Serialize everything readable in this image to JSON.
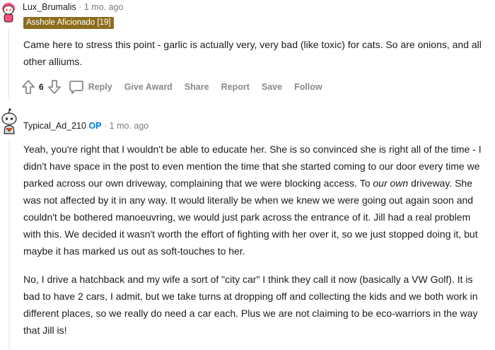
{
  "comment1": {
    "username": "Lux_Brumalis",
    "separator": "·",
    "time_ago": "1 mo. ago",
    "flair": "Asshole Aficionado [19]",
    "body": "Came here to stress this point - garlic is actually very, very bad (like toxic) for cats. So are onions, and all other alliums.",
    "vote_count": "6",
    "actions": {
      "reply": "Reply",
      "give_award": "Give Award",
      "share": "Share",
      "report": "Report",
      "save": "Save",
      "follow": "Follow"
    }
  },
  "comment2": {
    "username": "Typical_Ad_210",
    "op_badge": "OP",
    "separator": "·",
    "time_ago": "1 mo. ago",
    "paragraph1_before": "Yeah, you're right that I wouldn't be able to educate her. She is so convinced she is right all of the time - I didn't have space in the post to even mention the time that she started coming to our door every time we parked across our own driveway, complaining that we were blocking access. To ",
    "paragraph1_em": "our own",
    "paragraph1_after": " driveway. She was not affected by it in any way. It would literally be when we knew we were going out again soon and couldn't be bothered manoeuvring, we would just park across the entrance of it. Jill had a real problem with this. We decided it wasn't worth the effort of fighting with her over it, so we just stopped doing it, but maybe it has marked us out as soft-touches to her.",
    "paragraph2": "No, I drive a hatchback and my wife a sort of \"city car\" I think they call it now (basically a VW Golf). It is bad to have 2 cars, I admit, but we take turns at dropping off and collecting the kids and we both work in different places, so we really do need a car each. Plus we are not claiming to be eco-warriors in the way that Jill is!"
  },
  "colors": {
    "flair_bg": "#8c6d1f",
    "op_blue": "#0079d3",
    "meta_gray": "#878a8c"
  }
}
